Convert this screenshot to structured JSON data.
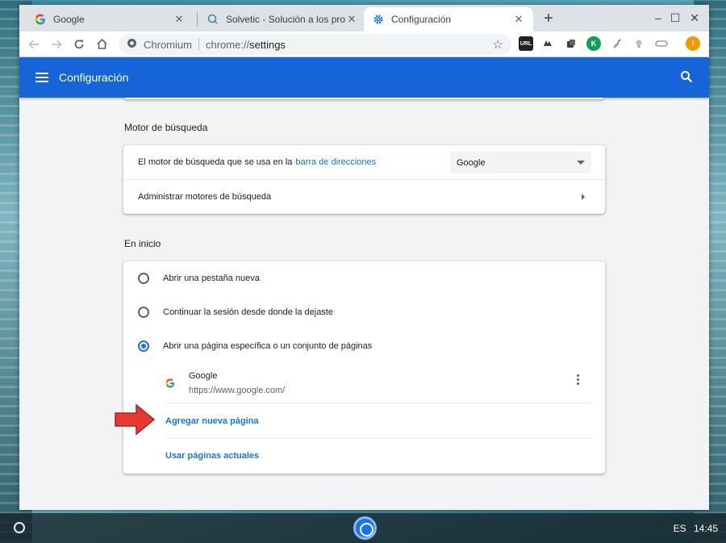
{
  "tabs": [
    {
      "title": "Google",
      "icon": "google-g-icon"
    },
    {
      "title": "Solvetic - Solución a los problem",
      "icon": "solvetic-icon"
    },
    {
      "title": "Configuración",
      "icon": "gear-icon"
    }
  ],
  "new_tab": "+",
  "window_controls": {
    "minimize": "–",
    "maximize": "☐",
    "close": "✕"
  },
  "omnibox": {
    "site_label": "Chromium",
    "scheme": "chrome://",
    "host": "settings"
  },
  "extensions": [
    {
      "name": "url-extension-icon",
      "label": "URL",
      "color": "#202124"
    },
    {
      "name": "hat-extension-icon",
      "label": "",
      "color": "#5f6368"
    },
    {
      "name": "copy-extension-icon",
      "label": "",
      "color": "#5f6368"
    },
    {
      "name": "k-extension-icon",
      "label": "K",
      "color": "#0f9d58"
    },
    {
      "name": "brush-extension-icon",
      "label": "",
      "color": "#9aa0a6"
    },
    {
      "name": "bulb-extension-icon",
      "label": "",
      "color": "#9aa0a6"
    },
    {
      "name": "link-extension-icon",
      "label": "",
      "color": "#9aa0a6"
    },
    {
      "name": "alert-extension-icon",
      "label": "!",
      "color": "#f29900"
    }
  ],
  "header": {
    "title": "Configuración"
  },
  "search_engine": {
    "section_title": "Motor de búsqueda",
    "row1_text": "El motor de búsqueda que se usa en la",
    "row1_link": "barra de direcciones",
    "selected_engine": "Google",
    "row2_text": "Administrar motores de búsqueda"
  },
  "startup": {
    "section_title": "En inicio",
    "options": [
      {
        "label": "Abrir una pestaña nueva",
        "selected": false
      },
      {
        "label": "Continuar la sesión desde donde la dejaste",
        "selected": false
      },
      {
        "label": "Abrir una página específica o un conjunto de páginas",
        "selected": true
      }
    ],
    "page": {
      "name": "Google",
      "url": "https://www.google.com/"
    },
    "add_page": "Agregar nueva página",
    "use_current": "Usar páginas actuales"
  },
  "tray": {
    "lang": "ES",
    "time": "14:45"
  },
  "colors": {
    "accent": "#1a73e8",
    "header": "#1565d8",
    "arrow": "#e53935"
  }
}
